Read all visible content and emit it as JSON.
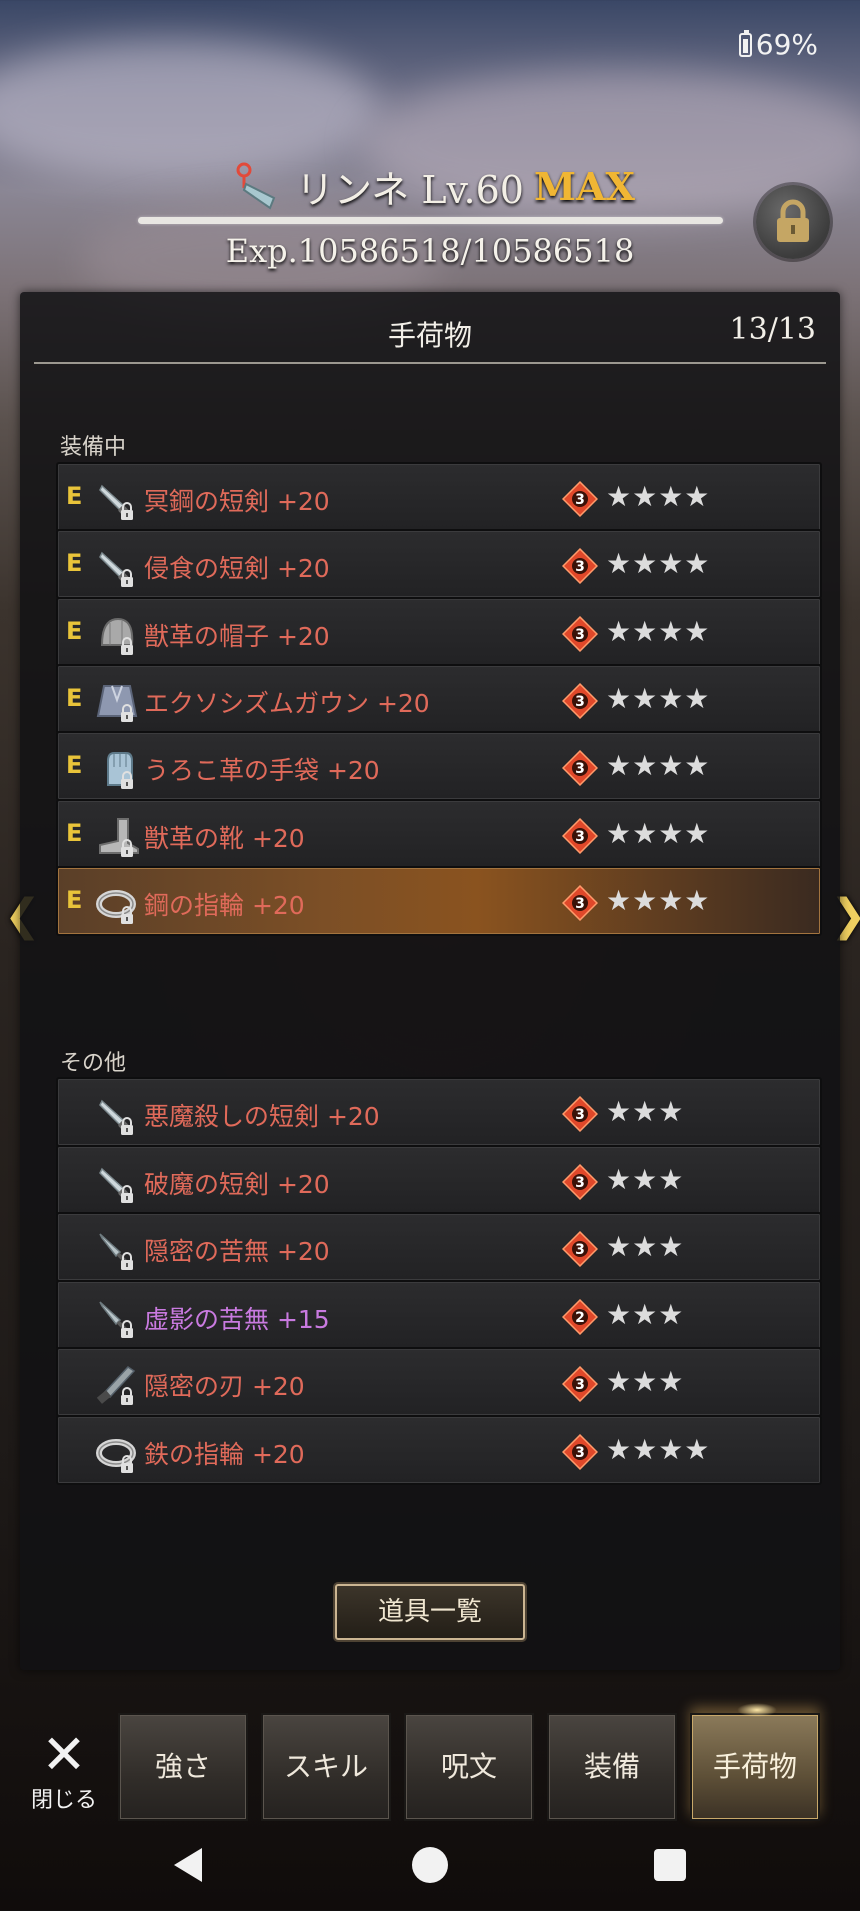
{
  "status_bar": {
    "battery": "69%"
  },
  "character": {
    "name": "リンネ Lv.60",
    "max_badge": "MAX",
    "exp": "Exp.10586518/10586518",
    "exp_progress": 1.0
  },
  "panel": {
    "title": "手荷物",
    "count": "13/13",
    "sections": {
      "equipped_label": "装備中",
      "other_label": "その他"
    }
  },
  "equipped_items": [
    {
      "equip_mark": "E",
      "icon": "dagger-icon",
      "name": "冥鋼の短剣 +20",
      "rank": "3",
      "stars": "★★★★",
      "name_color": "#e06a5a",
      "selected": false
    },
    {
      "equip_mark": "E",
      "icon": "dagger-icon",
      "name": "侵食の短剣 +20",
      "rank": "3",
      "stars": "★★★★",
      "name_color": "#e06a5a",
      "selected": false
    },
    {
      "equip_mark": "E",
      "icon": "hat-icon",
      "name": "獣革の帽子 +20",
      "rank": "3",
      "stars": "★★★★",
      "name_color": "#e06a5a",
      "selected": false
    },
    {
      "equip_mark": "E",
      "icon": "gown-icon",
      "name": "エクソシズムガウン +20",
      "rank": "3",
      "stars": "★★★★",
      "name_color": "#e06a5a",
      "selected": false
    },
    {
      "equip_mark": "E",
      "icon": "glove-icon",
      "name": "うろこ革の手袋 +20",
      "rank": "3",
      "stars": "★★★★",
      "name_color": "#e06a5a",
      "selected": false
    },
    {
      "equip_mark": "E",
      "icon": "boot-icon",
      "name": "獣革の靴 +20",
      "rank": "3",
      "stars": "★★★★",
      "name_color": "#e06a5a",
      "selected": false
    },
    {
      "equip_mark": "E",
      "icon": "ring-icon",
      "name": "鋼の指輪 +20",
      "rank": "3",
      "stars": "★★★★",
      "name_color": "#e06a5a",
      "selected": true
    }
  ],
  "other_items": [
    {
      "icon": "dagger-icon",
      "name": "悪魔殺しの短剣 +20",
      "rank": "3",
      "stars": "★★★",
      "name_color": "#e06a5a"
    },
    {
      "icon": "dagger-icon",
      "name": "破魔の短剣 +20",
      "rank": "3",
      "stars": "★★★",
      "name_color": "#e06a5a"
    },
    {
      "icon": "kunai-icon",
      "name": "隠密の苦無 +20",
      "rank": "3",
      "stars": "★★★",
      "name_color": "#e06a5a"
    },
    {
      "icon": "kunai-icon",
      "name": "虚影の苦無 +15",
      "rank": "2",
      "stars": "★★★",
      "name_color": "#c97ae0"
    },
    {
      "icon": "blade-icon",
      "name": "隠密の刃 +20",
      "rank": "3",
      "stars": "★★★",
      "name_color": "#e06a5a"
    },
    {
      "icon": "ring-icon",
      "name": "鉄の指輪 +20",
      "rank": "3",
      "stars": "★★★★",
      "name_color": "#e06a5a"
    }
  ],
  "buttons": {
    "tool_list": "道具一覧",
    "close_label": "閉じる"
  },
  "tabs": [
    {
      "label": "強さ",
      "active": false
    },
    {
      "label": "スキル",
      "active": false
    },
    {
      "label": "呪文",
      "active": false
    },
    {
      "label": "装備",
      "active": false
    },
    {
      "label": "手荷物",
      "active": true
    }
  ],
  "colors": {
    "rare_red": "#e06a5a",
    "rare_purple": "#c97ae0",
    "equip_mark": "#e9c43a",
    "max_gold": "#f0b634",
    "rank_badge": "#e0482a"
  }
}
